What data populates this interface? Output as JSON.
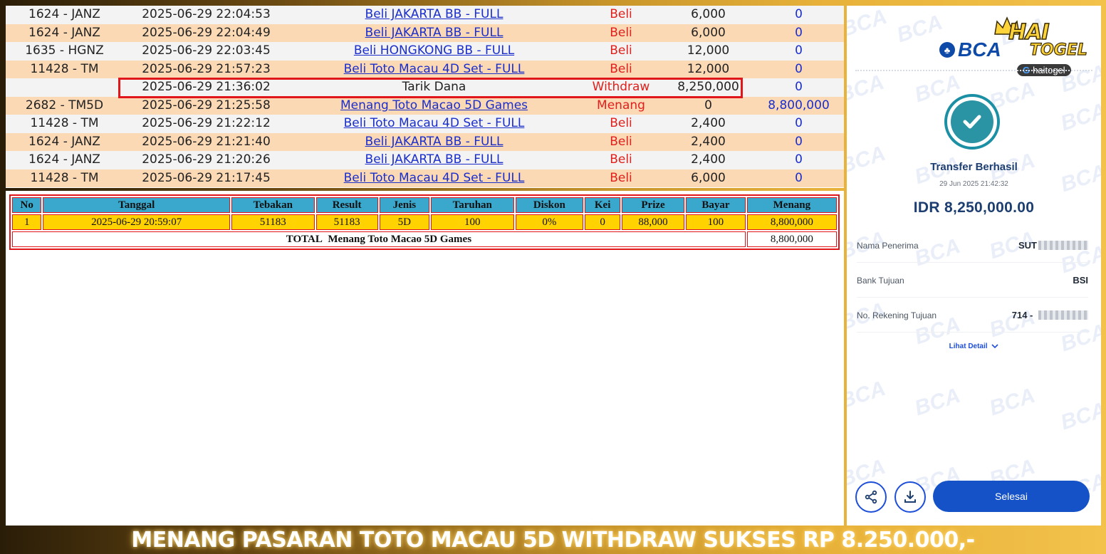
{
  "transactions": [
    {
      "kode": "1624 - JANZ",
      "tanggal": "2025-06-29 22:04:53",
      "keterangan": "Beli JAKARTA BB - FULL",
      "link": true,
      "jenis": "Beli",
      "jumlah": "6,000",
      "menang": "0"
    },
    {
      "kode": "1624 - JANZ",
      "tanggal": "2025-06-29 22:04:49",
      "keterangan": "Beli JAKARTA BB - FULL",
      "link": true,
      "jenis": "Beli",
      "jumlah": "6,000",
      "menang": "0"
    },
    {
      "kode": "1635 - HGNZ",
      "tanggal": "2025-06-29 22:03:45",
      "keterangan": "Beli HONGKONG BB - FULL",
      "link": true,
      "jenis": "Beli",
      "jumlah": "12,000",
      "menang": "0"
    },
    {
      "kode": "11428 - TM",
      "tanggal": "2025-06-29 21:57:23",
      "keterangan": "Beli Toto Macau 4D Set - FULL",
      "link": true,
      "jenis": "Beli",
      "jumlah": "12,000",
      "menang": "0"
    },
    {
      "kode": "",
      "tanggal": "2025-06-29 21:36:02",
      "keterangan": "Tarik Dana",
      "link": false,
      "jenis": "Withdraw",
      "jumlah": "8,250,000",
      "menang": "0"
    },
    {
      "kode": "2682 - TM5D",
      "tanggal": "2025-06-29 21:25:58",
      "keterangan": "Menang Toto Macao 5D Games",
      "link": true,
      "jenis": "Menang",
      "jumlah": "0",
      "menang": "8,800,000"
    },
    {
      "kode": "11428 - TM",
      "tanggal": "2025-06-29 21:22:12",
      "keterangan": "Beli Toto Macau 4D Set - FULL",
      "link": true,
      "jenis": "Beli",
      "jumlah": "2,400",
      "menang": "0"
    },
    {
      "kode": "1624 - JANZ",
      "tanggal": "2025-06-29 21:21:40",
      "keterangan": "Beli JAKARTA BB - FULL",
      "link": true,
      "jenis": "Beli",
      "jumlah": "2,400",
      "menang": "0"
    },
    {
      "kode": "1624 - JANZ",
      "tanggal": "2025-06-29 21:20:26",
      "keterangan": "Beli JAKARTA BB - FULL",
      "link": true,
      "jenis": "Beli",
      "jumlah": "2,400",
      "menang": "0"
    },
    {
      "kode": "11428 - TM",
      "tanggal": "2025-06-29 21:17:45",
      "keterangan": "Beli Toto Macau 4D Set - FULL",
      "link": true,
      "jenis": "Beli",
      "jumlah": "6,000",
      "menang": "0"
    }
  ],
  "detail": {
    "headers": [
      "No",
      "Tanggal",
      "Tebakan",
      "Result",
      "Jenis",
      "Taruhan",
      "Diskon",
      "Kei",
      "Prize",
      "Bayar",
      "Menang"
    ],
    "rows": [
      [
        "1",
        "2025-06-29 20:59:07",
        "51183",
        "51183",
        "5D",
        "100",
        "0%",
        "0",
        "88,000",
        "100",
        "8,800,000"
      ]
    ],
    "total_prefix": "TOTAL",
    "total_label": "Menang Toto Macao 5D Games",
    "total_value": "8,800,000"
  },
  "receipt": {
    "bank_logo": "BCA",
    "watermark": "BCA",
    "brand_name_1": "HAI",
    "brand_name_2": "TOGEL",
    "brand_handle": "haitogel",
    "status_icon": "check-circle-icon",
    "title": "Transfer Berhasil",
    "datetime": "29 Jun 2025 21:42:32",
    "amount": "IDR 8,250,000.00",
    "fields": [
      {
        "label": "Nama Penerima",
        "value": "SUT"
      },
      {
        "label": "Bank Tujuan",
        "value": "BSI"
      },
      {
        "label": "No. Rekening Tujuan",
        "value": "714 -"
      }
    ],
    "detail_link": "Lihat Detail",
    "share_icon": "share-icon",
    "download_icon": "download-icon",
    "done_button": "Selesai"
  },
  "banner": "MENANG PASARAN TOTO MACAU 5D WITHDRAW SUKSES RP 8.250.000,-",
  "colors": {
    "row_odd": "#f3f3f3",
    "row_even": "#fcd9b5",
    "link_blue": "#1a2ecc",
    "jenis_red": "#e0201c",
    "highlight_red": "#e0161b",
    "header_blue": "#3aa7cc",
    "data_yellow": "#ffd200",
    "bca_blue": "#0e4aa8",
    "button_blue": "#1551c7"
  }
}
